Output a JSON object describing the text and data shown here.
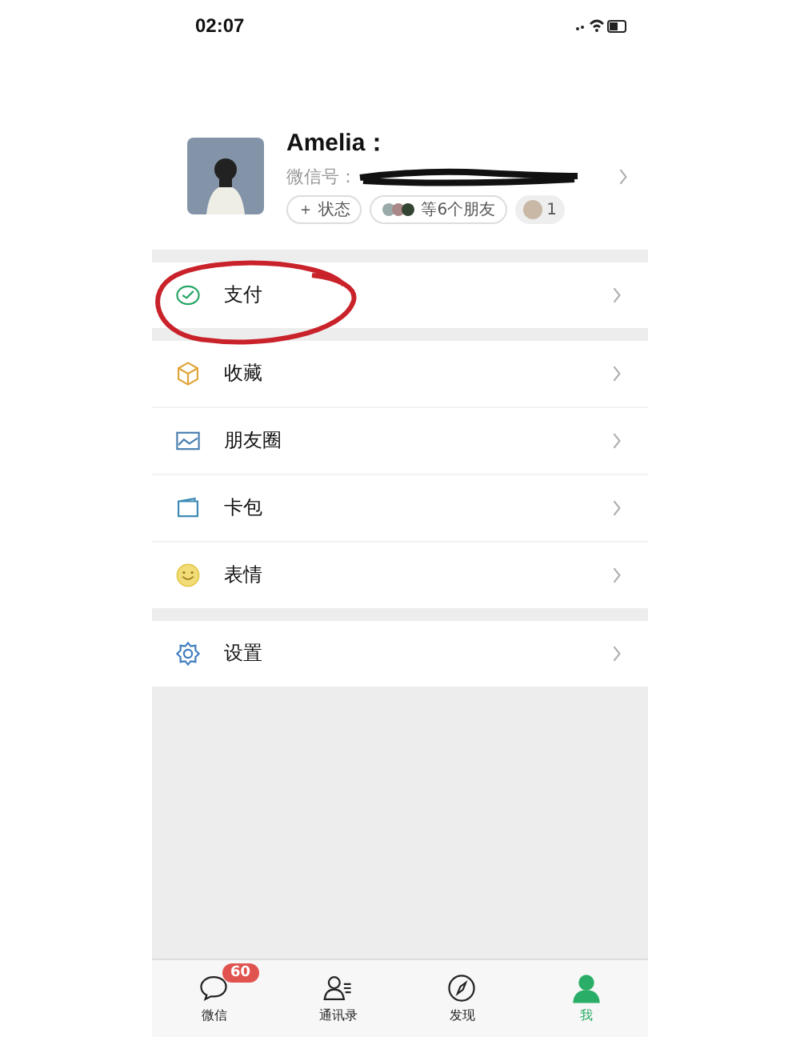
{
  "status_bar": {
    "time": "02:07"
  },
  "profile": {
    "name": "Amelia：",
    "id_label": "微信号：",
    "status_button": "＋ 状态",
    "friends": "等6个朋友",
    "notice_count": "1"
  },
  "menu_groups": [
    [
      {
        "kind": "pay",
        "label": "支付"
      }
    ],
    [
      {
        "kind": "favorites",
        "label": "收藏"
      },
      {
        "kind": "moments",
        "label": "朋友圈"
      },
      {
        "kind": "cards",
        "label": "卡包"
      },
      {
        "kind": "stickers",
        "label": "表情"
      }
    ],
    [
      {
        "kind": "settings",
        "label": "设置"
      }
    ]
  ],
  "tab_bar": [
    {
      "kind": "chats",
      "label": "微信",
      "badge": "60",
      "selected": false
    },
    {
      "kind": "contacts",
      "label": "通讯录",
      "selected": false
    },
    {
      "kind": "discover",
      "label": "发现",
      "selected": false
    },
    {
      "kind": "me",
      "label": "我",
      "selected": true
    }
  ]
}
